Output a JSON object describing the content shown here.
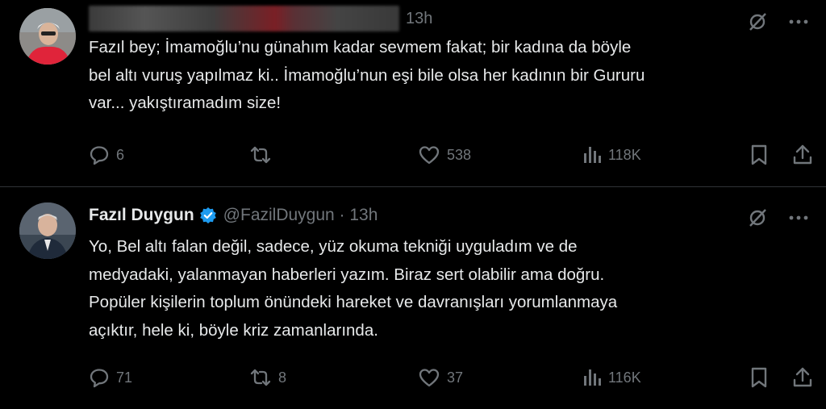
{
  "reply_tweet": {
    "time": "13h",
    "text": "Fazıl bey; İmamoğlu’nu günahım kadar sevmem fakat; bir kadına da böyle\nbel altı vuruş yapılmaz ki..  İmamoğlu’nun eşi bile olsa her kadının bir Gururu\nvar... yakıştıramadım size!",
    "replies": "6",
    "reposts": "",
    "likes": "538",
    "views": "118K"
  },
  "author_tweet": {
    "display_name": "Fazıl Duygun",
    "handle_time": "@FazilDuygun · 13h",
    "text": "Yo, Bel altı falan değil, sadece,  yüz okuma tekniği uyguladım ve de\nmedyadaki, yalanmayan haberleri yazım. Biraz sert olabilir ama doğru.\nPopüler kişilerin toplum önündeki hareket ve davranışları yorumlanmaya\naçıktır, hele ki, böyle kriz zamanlarında.",
    "replies": "71",
    "reposts": "8",
    "likes": "37",
    "views": "116K"
  },
  "colors": {
    "background": "#000000",
    "text": "#e7e9ea",
    "muted": "#71767b",
    "verified": "#1d9bf0",
    "divider": "#2f3336"
  },
  "icons": [
    "grok-slash-icon",
    "more-icon",
    "reply-icon",
    "repost-icon",
    "like-icon",
    "views-icon",
    "bookmark-icon",
    "share-icon"
  ]
}
